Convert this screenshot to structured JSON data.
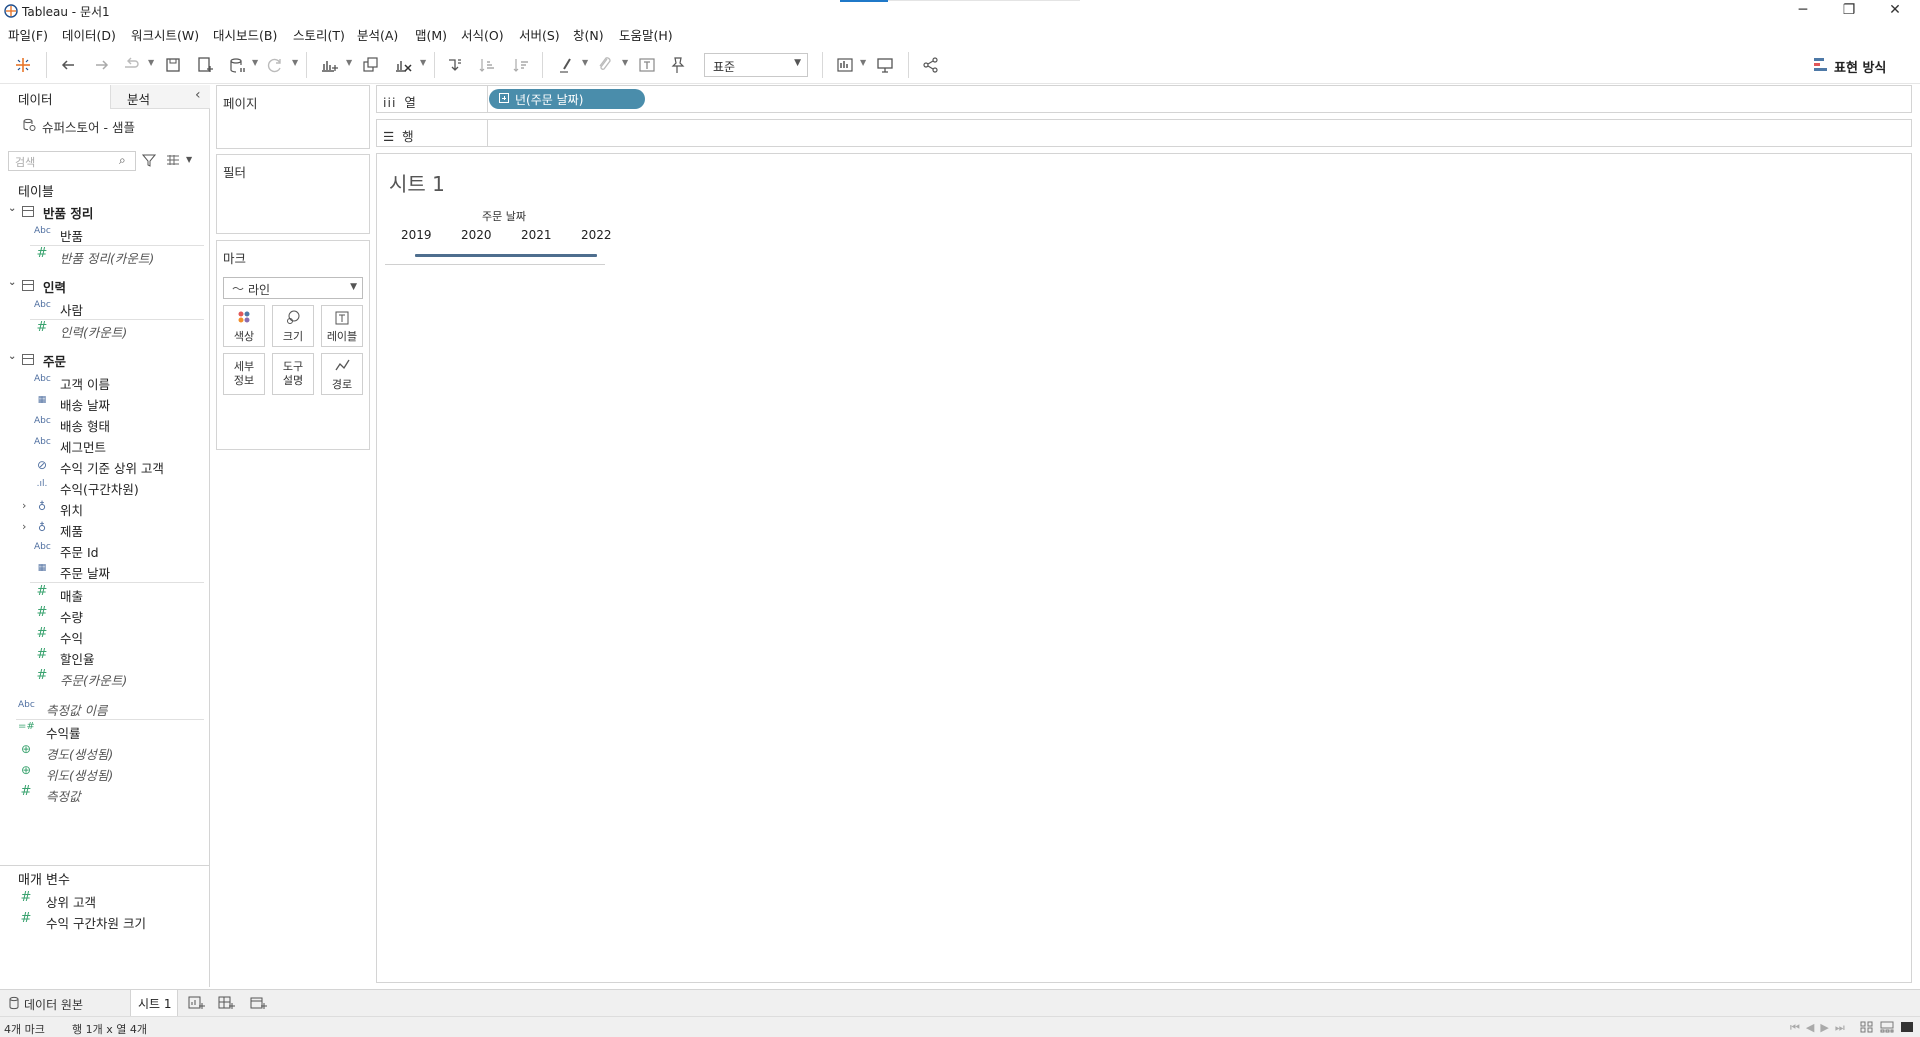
{
  "window": {
    "title": "Tableau - 문서1",
    "minimize": "─",
    "restore": "❐",
    "close": "✕"
  },
  "menu": [
    "파일(F)",
    "데이터(D)",
    "워크시트(W)",
    "대시보드(B)",
    "스토리(T)",
    "분석(A)",
    "맵(M)",
    "서식(O)",
    "서버(S)",
    "창(N)",
    "도움말(H)"
  ],
  "toolbar": {
    "fit": "표준",
    "show_me": "표현 방식"
  },
  "data_pane": {
    "tab_data": "데이터",
    "tab_analysis": "분석",
    "datasource": "슈퍼스토어 - 샘플",
    "search_placeholder": "검색",
    "tables_header": "테이블",
    "tables": [
      {
        "name": "반품 정리",
        "fields": [
          {
            "icon": "Abc",
            "name": "반품"
          },
          {
            "icon": "#",
            "name": "반품 정리(카운트)"
          }
        ]
      },
      {
        "name": "인력",
        "fields": [
          {
            "icon": "Abc",
            "name": "사람"
          },
          {
            "icon": "#",
            "name": "인력(카운트)"
          }
        ]
      },
      {
        "name": "주문",
        "fields": [
          {
            "icon": "Abc",
            "name": "고객 이름"
          },
          {
            "icon": "date",
            "name": "배송 날짜"
          },
          {
            "icon": "Abc",
            "name": "배송 형태"
          },
          {
            "icon": "Abc",
            "name": "세그먼트"
          },
          {
            "icon": "set",
            "name": "수익 기준 상위 고객"
          },
          {
            "icon": "bin",
            "name": "수익(구간차원)"
          },
          {
            "icon": "hier",
            "name": "위치"
          },
          {
            "icon": "hier",
            "name": "제품"
          },
          {
            "icon": "Abc",
            "name": "주문 Id"
          },
          {
            "icon": "date",
            "name": "주문 날짜"
          },
          {
            "icon": "#",
            "name": "매출"
          },
          {
            "icon": "#",
            "name": "수량"
          },
          {
            "icon": "#",
            "name": "수익"
          },
          {
            "icon": "#",
            "name": "할인율"
          },
          {
            "icon": "#",
            "name": "주문(카운트)"
          }
        ]
      }
    ],
    "extra_fields": [
      {
        "icon": "Abc",
        "name": "측정값 이름"
      },
      {
        "icon": "=#",
        "name": "수익률"
      },
      {
        "icon": "globe",
        "name": "경도(생성됨)"
      },
      {
        "icon": "globe",
        "name": "위도(생성됨)"
      },
      {
        "icon": "#",
        "name": "측정값"
      }
    ],
    "params_header": "매개 변수",
    "params": [
      {
        "icon": "#",
        "name": "상위 고객"
      },
      {
        "icon": "#",
        "name": "수익 구간차원 크기"
      }
    ]
  },
  "cards": {
    "pages": "페이지",
    "filters": "필터",
    "marks": "마크",
    "mark_type": "라인",
    "mark_buttons": [
      {
        "label1": "색상",
        "label2": ""
      },
      {
        "label1": "크기",
        "label2": ""
      },
      {
        "label1": "레이블",
        "label2": ""
      },
      {
        "label1": "세부",
        "label2": "정보"
      },
      {
        "label1": "도구",
        "label2": "설명"
      },
      {
        "label1": "경로",
        "label2": ""
      }
    ]
  },
  "shelves": {
    "columns_label": "열",
    "rows_label": "행",
    "column_pill": "년(주문 날짜)"
  },
  "view": {
    "title": "시트 1",
    "header_field": "주문 날짜",
    "years": [
      "2019",
      "2020",
      "2021",
      "2022"
    ]
  },
  "tabs": {
    "datasource": "데이터 원본",
    "sheet1": "시트 1"
  },
  "status": {
    "marks": "4개 마크",
    "dims": "행 1개 x 열 4개"
  },
  "colors": {
    "pill": "#4a8dab",
    "line": "#4e6e8e",
    "measure_icon": "#3aa36f"
  }
}
